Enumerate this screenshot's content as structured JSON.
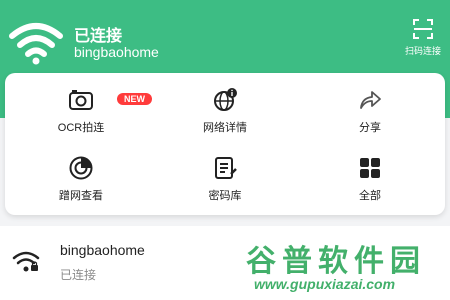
{
  "colors": {
    "header": "#3dbd84",
    "badge": "#ff3b3b",
    "watermark": "#43b06b"
  },
  "header": {
    "status": "已连接",
    "network_name": "bingbaohome",
    "scan_label": "扫码连接",
    "wifi_icon": "wifi-icon",
    "scan_icon": "scan-icon"
  },
  "tools": [
    {
      "label": "OCR拍连",
      "icon": "camera-icon",
      "badge": "NEW"
    },
    {
      "label": "网络详情",
      "icon": "globe-info-icon"
    },
    {
      "label": "分享",
      "icon": "share-icon"
    },
    {
      "label": "蹭网查看",
      "icon": "radar-icon"
    },
    {
      "label": "密码库",
      "icon": "password-icon"
    },
    {
      "label": "全部",
      "icon": "grid-icon"
    }
  ],
  "network_list": [
    {
      "name": "bingbaohome",
      "status": "已连接",
      "icon": "wifi-lock-icon"
    }
  ],
  "watermark": {
    "title": "谷普软件园",
    "url": "www.gupuxiazai.com"
  }
}
